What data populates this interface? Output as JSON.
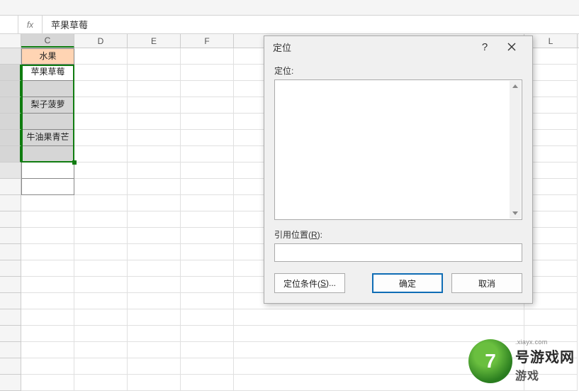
{
  "formula_bar": {
    "fx": "fx",
    "value": "苹果草莓"
  },
  "columns": [
    "C",
    "D",
    "E",
    "F",
    "",
    "",
    "L"
  ],
  "cells": {
    "header": "水果",
    "r2": "苹果草莓",
    "r4": "梨子菠萝",
    "r6": "牛油果青芒"
  },
  "dialog": {
    "title": "定位",
    "goto_label": "定位:",
    "ref_label_pre": "引用位置(",
    "ref_label_key": "R",
    "ref_label_post": "):",
    "special_pre": "定位条件(",
    "special_key": "S",
    "special_post": ")...",
    "ok": "确定",
    "cancel": "取消",
    "help": "?"
  },
  "watermark": {
    "num": "7",
    "brand_suffix": "号游戏网",
    "url": ".xiayx.com",
    "sub": "游戏"
  }
}
